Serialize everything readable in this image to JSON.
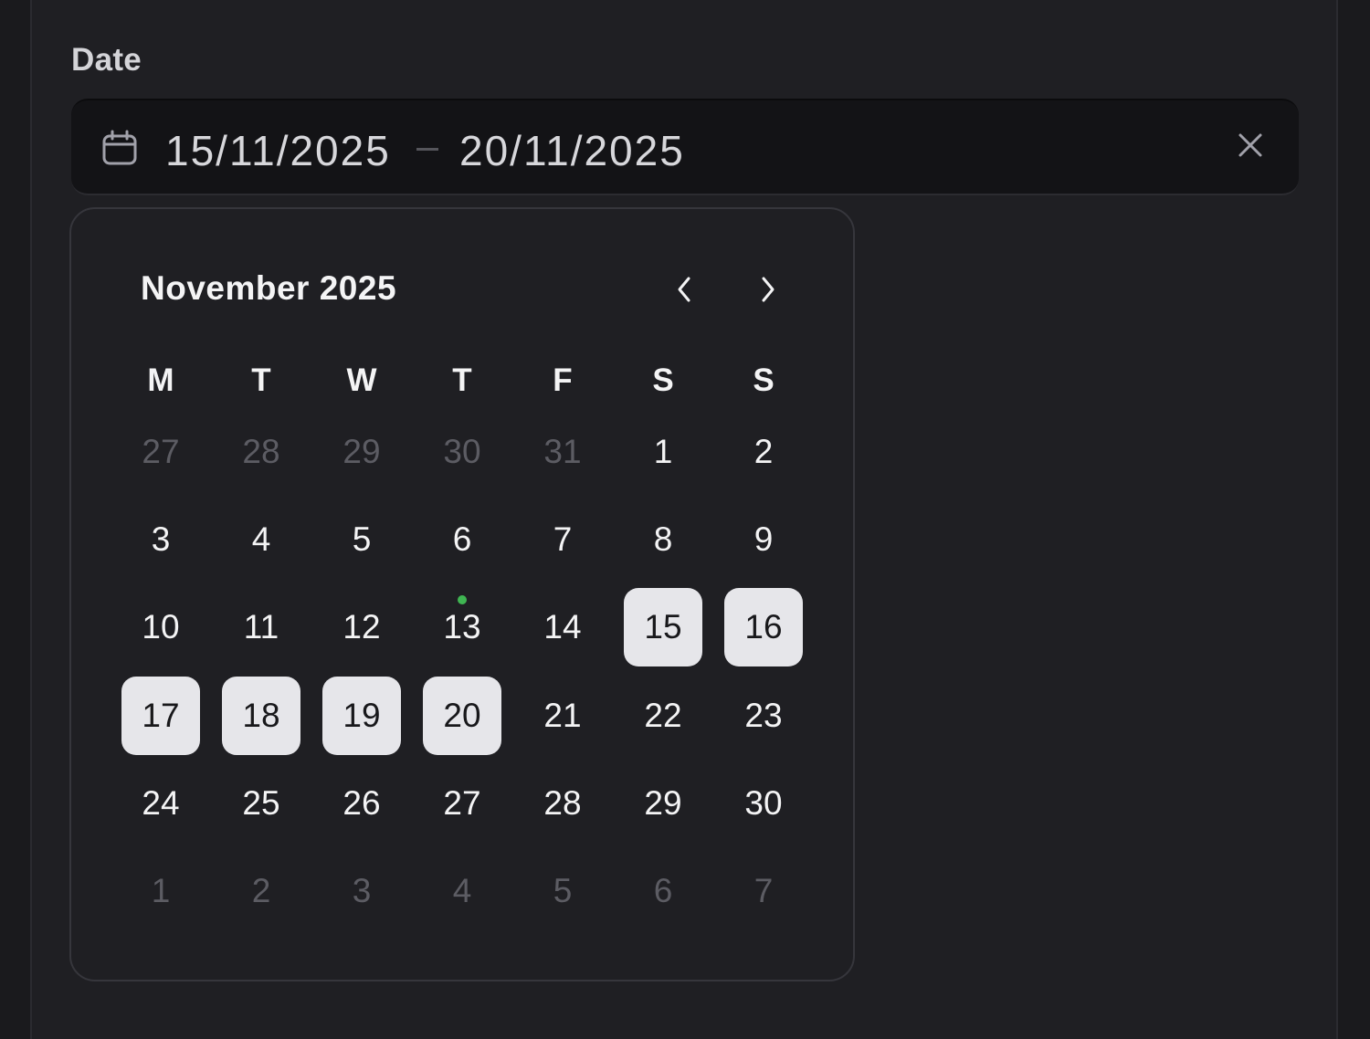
{
  "field": {
    "label": "Date",
    "start_date": "15/11/2025",
    "end_date": "20/11/2025"
  },
  "calendar": {
    "month_title": "November 2025",
    "weekdays": [
      "M",
      "T",
      "W",
      "T",
      "F",
      "S",
      "S"
    ],
    "weeks": [
      [
        {
          "d": "27",
          "o": true
        },
        {
          "d": "28",
          "o": true
        },
        {
          "d": "29",
          "o": true
        },
        {
          "d": "30",
          "o": true
        },
        {
          "d": "31",
          "o": true
        },
        {
          "d": "1"
        },
        {
          "d": "2"
        }
      ],
      [
        {
          "d": "3"
        },
        {
          "d": "4"
        },
        {
          "d": "5"
        },
        {
          "d": "6"
        },
        {
          "d": "7"
        },
        {
          "d": "8"
        },
        {
          "d": "9"
        }
      ],
      [
        {
          "d": "10"
        },
        {
          "d": "11"
        },
        {
          "d": "12"
        },
        {
          "d": "13",
          "today": true
        },
        {
          "d": "14"
        },
        {
          "d": "15",
          "sel": true
        },
        {
          "d": "16",
          "sel": true
        }
      ],
      [
        {
          "d": "17",
          "sel": true
        },
        {
          "d": "18",
          "sel": true
        },
        {
          "d": "19",
          "sel": true
        },
        {
          "d": "20",
          "sel": true
        },
        {
          "d": "21"
        },
        {
          "d": "22"
        },
        {
          "d": "23"
        }
      ],
      [
        {
          "d": "24"
        },
        {
          "d": "25"
        },
        {
          "d": "26"
        },
        {
          "d": "27"
        },
        {
          "d": "28"
        },
        {
          "d": "29"
        },
        {
          "d": "30"
        }
      ],
      [
        {
          "d": "1",
          "o": true
        },
        {
          "d": "2",
          "o": true
        },
        {
          "d": "3",
          "o": true
        },
        {
          "d": "4",
          "o": true
        },
        {
          "d": "5",
          "o": true
        },
        {
          "d": "6",
          "o": true
        },
        {
          "d": "7",
          "o": true
        }
      ]
    ]
  },
  "icons": {
    "calendar": "calendar-icon",
    "clear": "close-icon",
    "prev": "chevron-left-icon",
    "next": "chevron-right-icon"
  },
  "colors": {
    "selected_bg": "#e6e6ea",
    "today_dot": "#3fb552",
    "outside_text": "#5c5c63"
  }
}
